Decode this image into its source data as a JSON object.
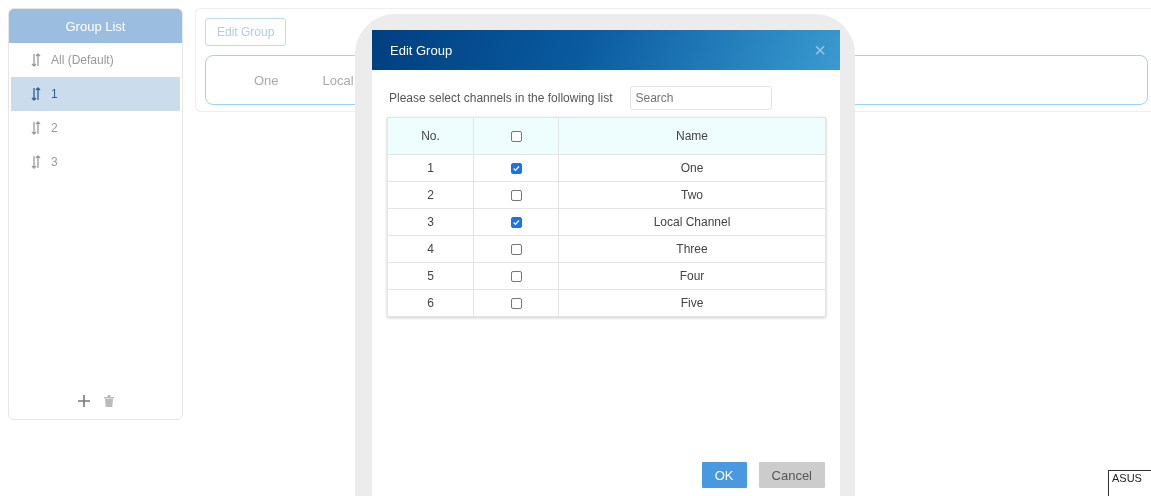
{
  "group_list": {
    "title": "Group List",
    "items": [
      {
        "label": "All (Default)",
        "selected": false
      },
      {
        "label": "1",
        "selected": true
      },
      {
        "label": "2",
        "selected": false
      },
      {
        "label": "3",
        "selected": false
      }
    ]
  },
  "group_panel": {
    "edit_button": "Edit Group",
    "channels": [
      "One",
      "Local"
    ]
  },
  "dialog": {
    "title": "Edit Group",
    "close": "×",
    "prompt": "Please select channels in the following list",
    "search": {
      "placeholder": "Search"
    },
    "columns": [
      "No.",
      "Name"
    ],
    "select_all": false,
    "rows": [
      {
        "no": "1",
        "checked": true,
        "name": "One"
      },
      {
        "no": "2",
        "checked": false,
        "name": "Two"
      },
      {
        "no": "3",
        "checked": true,
        "name": "Local Channel"
      },
      {
        "no": "4",
        "checked": false,
        "name": "Three"
      },
      {
        "no": "5",
        "checked": false,
        "name": "Four"
      },
      {
        "no": "6",
        "checked": false,
        "name": "Five"
      }
    ],
    "buttons": [
      {
        "label": "OK",
        "kind": "primary"
      },
      {
        "label": "Cancel",
        "kind": "secondary"
      }
    ]
  },
  "tooltip": "ASUS"
}
